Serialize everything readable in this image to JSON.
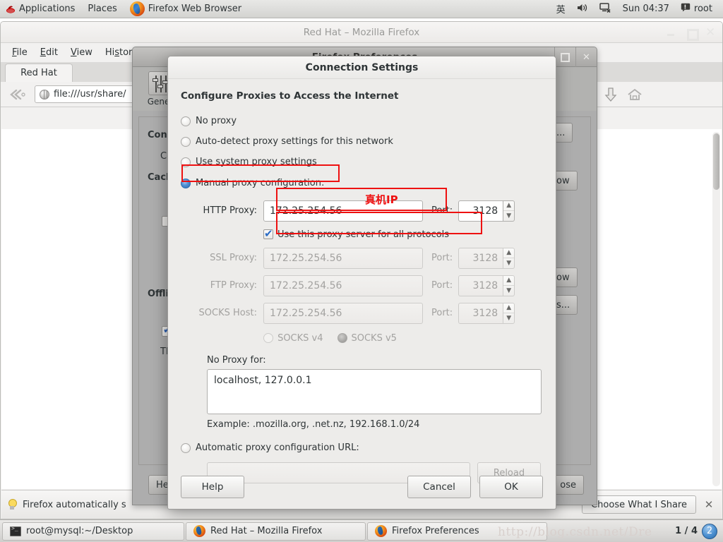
{
  "top_panel": {
    "applications": "Applications",
    "places": "Places",
    "active_app": "Firefox Web Browser",
    "tray": {
      "input_method": "英",
      "volume_icon": "volume-icon",
      "network_icon": "network-disconnected-icon",
      "clock": "Sun 04:37",
      "user_icon": "message-icon",
      "user": "root"
    }
  },
  "firefox_window": {
    "title": "Red Hat – Mozilla Firefox",
    "menus": [
      "File",
      "Edit",
      "View",
      "History"
    ],
    "tab_label": "Red Hat",
    "url": "file:///usr/share/",
    "icons": {
      "back": "back-arrow-icon",
      "globe": "globe-icon",
      "search": "search-icon",
      "download": "download-arrow-icon",
      "home": "home-icon"
    },
    "notification": {
      "text": "Firefox automatically s",
      "button": "Choose What I Share",
      "close": "✕"
    }
  },
  "prefs_window": {
    "title": "Firefox Preferences",
    "toolbar_item": "Gener",
    "sections": {
      "connection_head": "Conn",
      "connection_desc": "Co",
      "cache_head": "Cach",
      "offline_head": "Offli",
      "offline_desc": "Th"
    },
    "buttons": {
      "settings": "...",
      "clear_now_1": "ow",
      "clear_now_2": "ow",
      "exceptions": "s...",
      "help": "He",
      "close": "ose"
    }
  },
  "dialog": {
    "title": "Connection Settings",
    "heading": "Configure Proxies to Access the Internet",
    "proxy_modes": [
      {
        "label": "No proxy",
        "selected": false
      },
      {
        "label": "Auto-detect proxy settings for this network",
        "selected": false
      },
      {
        "label": "Use system proxy settings",
        "selected": false
      },
      {
        "label": "Manual proxy configuration:",
        "selected": true
      }
    ],
    "proxy_rows": [
      {
        "label": "HTTP Proxy:",
        "value": "172.25.254.56",
        "port_label": "Port:",
        "port": "3128",
        "enabled": true
      },
      {
        "label": "SSL Proxy:",
        "value": "172.25.254.56",
        "port_label": "Port:",
        "port": "3128",
        "enabled": false
      },
      {
        "label": "FTP Proxy:",
        "value": "172.25.254.56",
        "port_label": "Port:",
        "port": "3128",
        "enabled": false
      },
      {
        "label": "SOCKS Host:",
        "value": "172.25.254.56",
        "port_label": "Port:",
        "port": "3128",
        "enabled": false
      }
    ],
    "use_all_protocols": {
      "label": "Use this proxy server for all protocols",
      "checked": true
    },
    "socks_version": {
      "v4_label": "SOCKS v4",
      "v5_label": "SOCKS v5",
      "selected": "v5"
    },
    "no_proxy_label": "No Proxy for:",
    "no_proxy_value": "localhost, 127.0.0.1",
    "example_text": "Example: .mozilla.org, .net.nz, 192.168.1.0/24",
    "pac_label": "Automatic proxy configuration URL:",
    "pac_value": "",
    "reload_label": "Reload",
    "buttons": {
      "help": "Help",
      "cancel": "Cancel",
      "ok": "OK"
    },
    "annotation": {
      "text": "真机IP",
      "color": "#ee1111"
    }
  },
  "taskbar": {
    "items": [
      {
        "label": "root@mysql:~/Desktop",
        "icon": "terminal-icon"
      },
      {
        "label": "Red Hat – Mozilla Firefox",
        "icon": "firefox-icon"
      },
      {
        "label": "Firefox Preferences",
        "icon": "firefox-icon"
      }
    ],
    "watermark": "http://blog.csdn.net/Dre",
    "workspace_count": "1 / 4",
    "workspace_badge": "2"
  }
}
